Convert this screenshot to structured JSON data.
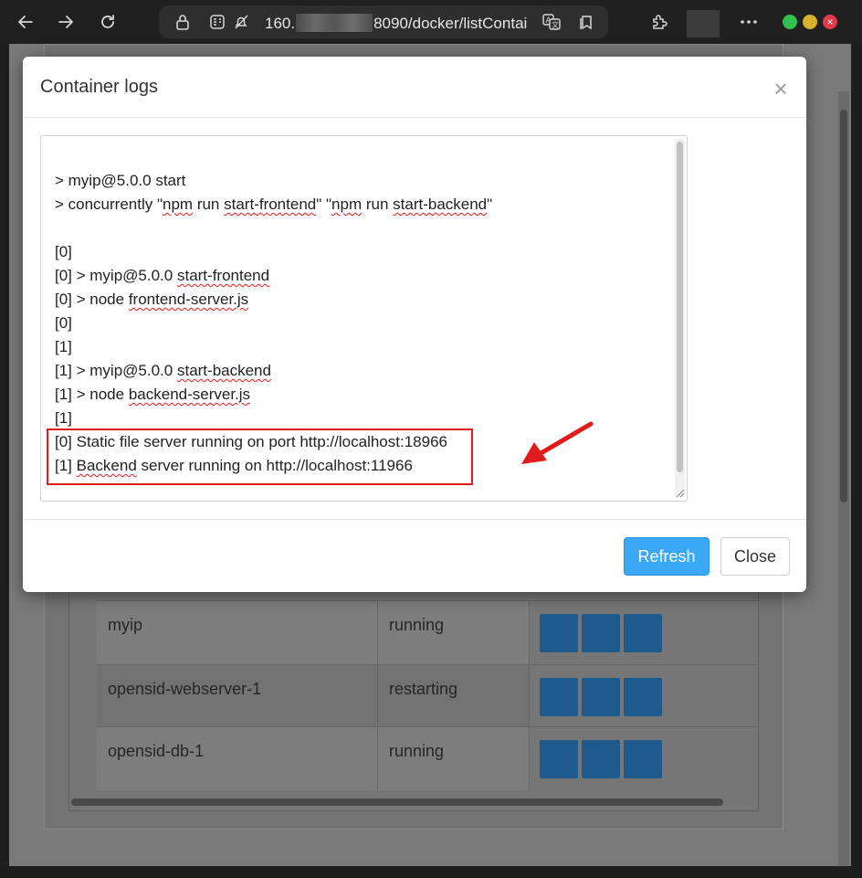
{
  "browser": {
    "url_prefix": "160.",
    "url_suffix": "8090/docker/listContai",
    "accent_green": "#2fc14d",
    "accent_yellow": "#d9b12c",
    "accent_red": "#e0394a"
  },
  "modal": {
    "title": "Container logs",
    "close_glyph": "×",
    "log_lines": [
      "> myip@5.0.0 start",
      "> concurrently \"npm run start-frontend\" \"npm run start-backend\"",
      "",
      "[0]",
      "[0] > myip@5.0.0 start-frontend",
      "[0] > node frontend-server.js",
      "[0]",
      "[1]",
      "[1] > myip@5.0.0 start-backend",
      "[1] > node backend-server.js",
      "[1]",
      "[0] Static file server running on port http://localhost:18966",
      "[1] Backend server running on http://localhost:11966"
    ],
    "refresh_label": "Refresh",
    "close_label": "Close",
    "refresh_color": "#3aa8f4",
    "highlight_color": "#e11b1b"
  },
  "background_table": {
    "rows": [
      {
        "name": "myip",
        "status": "running"
      },
      {
        "name": "opensid-webserver-1",
        "status": "restarting"
      },
      {
        "name": "opensid-db-1",
        "status": "running"
      }
    ]
  }
}
